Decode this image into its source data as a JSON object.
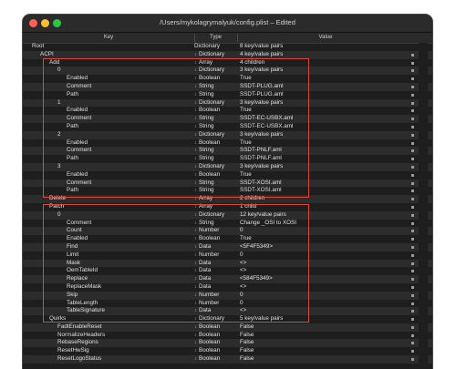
{
  "window": {
    "title": "/Users/mykolagrymalyuk/config.plist – Edited"
  },
  "columns": {
    "key": "Key",
    "type": "Type",
    "value": "Value"
  },
  "rows": [
    {
      "key": "Root",
      "type": "Dictionary",
      "value": "8 key/value pairs",
      "level": 0,
      "stepper": false,
      "handle": false
    },
    {
      "key": "ACPI",
      "type": "Dictionary",
      "value": "4 key/value pairs",
      "level": 1,
      "stepper": true,
      "handle": true
    },
    {
      "key": "Add",
      "type": "Array",
      "value": "4 children",
      "level": 2,
      "stepper": true,
      "handle": true
    },
    {
      "key": "0",
      "type": "Dictionary",
      "value": "3 key/value pairs",
      "level": 3,
      "stepper": true,
      "handle": true
    },
    {
      "key": "Enabled",
      "type": "Boolean",
      "value": "True",
      "level": 4,
      "stepper": true,
      "handle": true
    },
    {
      "key": "Comment",
      "type": "String",
      "value": "SSDT-PLUG.aml",
      "level": 4,
      "stepper": true,
      "handle": true
    },
    {
      "key": "Path",
      "type": "String",
      "value": "SSDT-PLUG.aml",
      "level": 4,
      "stepper": true,
      "handle": true
    },
    {
      "key": "1",
      "type": "Dictionary",
      "value": "3 key/value pairs",
      "level": 3,
      "stepper": true,
      "handle": true
    },
    {
      "key": "Enabled",
      "type": "Boolean",
      "value": "True",
      "level": 4,
      "stepper": true,
      "handle": true
    },
    {
      "key": "Comment",
      "type": "String",
      "value": "SSDT-EC-USBX.aml",
      "level": 4,
      "stepper": true,
      "handle": true
    },
    {
      "key": "Path",
      "type": "String",
      "value": "SSDT-EC-USBX.aml",
      "level": 4,
      "stepper": true,
      "handle": true
    },
    {
      "key": "2",
      "type": "Dictionary",
      "value": "3 key/value pairs",
      "level": 3,
      "stepper": true,
      "handle": true
    },
    {
      "key": "Enabled",
      "type": "Boolean",
      "value": "True",
      "level": 4,
      "stepper": true,
      "handle": true
    },
    {
      "key": "Comment",
      "type": "String",
      "value": "SSDT-PNLF.aml",
      "level": 4,
      "stepper": true,
      "handle": true
    },
    {
      "key": "Path",
      "type": "String",
      "value": "SSDT-PNLF.aml",
      "level": 4,
      "stepper": true,
      "handle": true
    },
    {
      "key": "3",
      "type": "Dictionary",
      "value": "3 key/value pairs",
      "level": 3,
      "stepper": true,
      "handle": true
    },
    {
      "key": "Enabled",
      "type": "Boolean",
      "value": "True",
      "level": 4,
      "stepper": true,
      "handle": true
    },
    {
      "key": "Comment",
      "type": "String",
      "value": "SSDT-XOSI.aml",
      "level": 4,
      "stepper": true,
      "handle": true
    },
    {
      "key": "Path",
      "type": "String",
      "value": "SSDT-XOSI.aml",
      "level": 4,
      "stepper": true,
      "handle": true
    },
    {
      "key": "Delete",
      "type": "Array",
      "value": "2 children",
      "level": 2,
      "stepper": true,
      "handle": true
    },
    {
      "key": "Patch",
      "type": "Array",
      "value": "1 child",
      "level": 2,
      "stepper": true,
      "handle": true
    },
    {
      "key": "0",
      "type": "Dictionary",
      "value": "12 key/value pairs",
      "level": 3,
      "stepper": true,
      "handle": true
    },
    {
      "key": "Comment",
      "type": "String",
      "value": "Change _OSI to XOSI",
      "level": 4,
      "stepper": true,
      "handle": true
    },
    {
      "key": "Count",
      "type": "Number",
      "value": "0",
      "level": 4,
      "stepper": true,
      "handle": true
    },
    {
      "key": "Enabled",
      "type": "Boolean",
      "value": "True",
      "level": 4,
      "stepper": true,
      "handle": true
    },
    {
      "key": "Find",
      "type": "Data",
      "value": "<5F4F5349>",
      "level": 4,
      "stepper": true,
      "handle": true
    },
    {
      "key": "Limit",
      "type": "Number",
      "value": "0",
      "level": 4,
      "stepper": true,
      "handle": true
    },
    {
      "key": "Mask",
      "type": "Data",
      "value": "<>",
      "level": 4,
      "stepper": true,
      "handle": true
    },
    {
      "key": "OemTableId",
      "type": "Data",
      "value": "<>",
      "level": 4,
      "stepper": true,
      "handle": true
    },
    {
      "key": "Replace",
      "type": "Data",
      "value": "<584F5349>",
      "level": 4,
      "stepper": true,
      "handle": true
    },
    {
      "key": "ReplaceMask",
      "type": "Data",
      "value": "<>",
      "level": 4,
      "stepper": true,
      "handle": true
    },
    {
      "key": "Skip",
      "type": "Number",
      "value": "0",
      "level": 4,
      "stepper": true,
      "handle": true
    },
    {
      "key": "TableLength",
      "type": "Number",
      "value": "0",
      "level": 4,
      "stepper": true,
      "handle": true
    },
    {
      "key": "TableSignature",
      "type": "Data",
      "value": "<>",
      "level": 4,
      "stepper": true,
      "handle": true
    },
    {
      "key": "Quirks",
      "type": "Dictionary",
      "value": "5 key/value pairs",
      "level": 2,
      "stepper": true,
      "handle": true
    },
    {
      "key": "FadtEnableReset",
      "type": "Boolean",
      "value": "False",
      "level": 3,
      "stepper": true,
      "handle": true
    },
    {
      "key": "NormalizeHeaders",
      "type": "Boolean",
      "value": "False",
      "level": 3,
      "stepper": true,
      "handle": true
    },
    {
      "key": "RebaseRegions",
      "type": "Boolean",
      "value": "False",
      "level": 3,
      "stepper": true,
      "handle": true
    },
    {
      "key": "ResetHwSig",
      "type": "Boolean",
      "value": "False",
      "level": 3,
      "stepper": true,
      "handle": true
    },
    {
      "key": "ResetLogoStatus",
      "type": "Boolean",
      "value": "False",
      "level": 3,
      "stepper": true,
      "handle": true
    }
  ],
  "colors": {
    "highlight": "#d94a3a",
    "background": "#1e1e1e",
    "alt_row": "#2c2c2c"
  }
}
